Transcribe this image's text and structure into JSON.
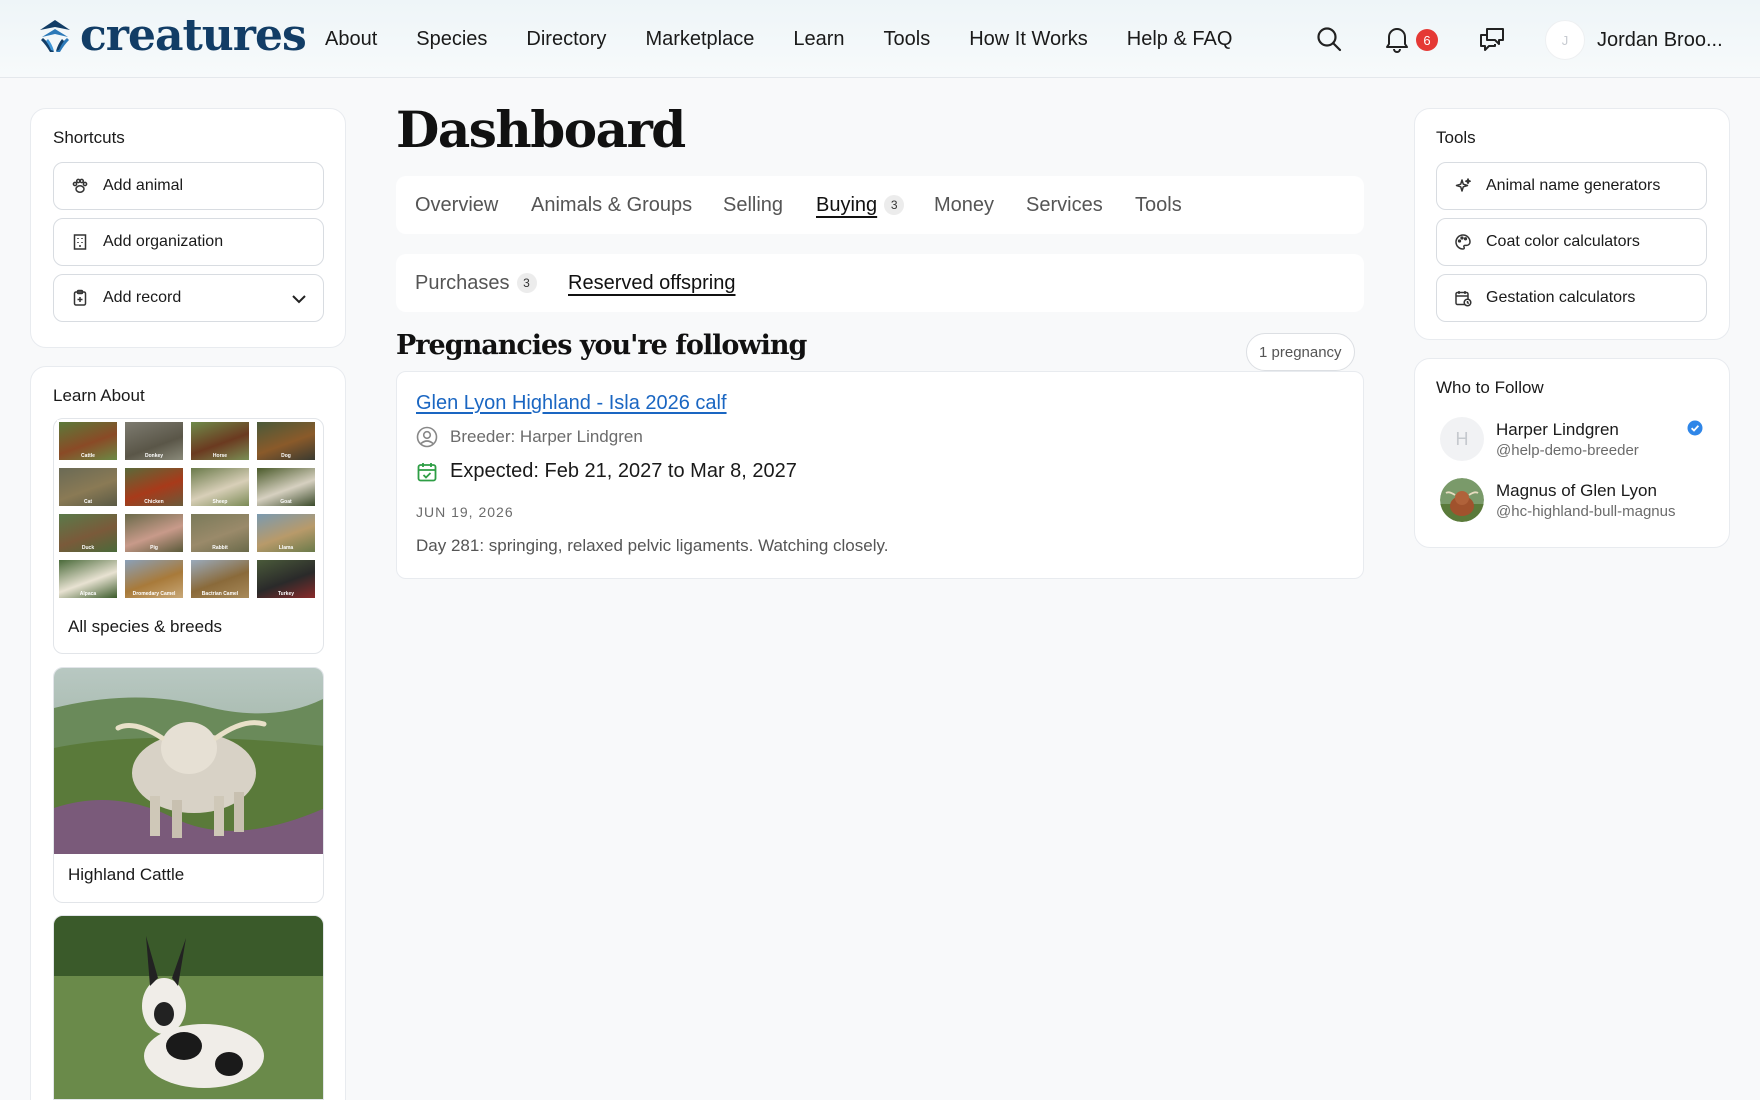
{
  "brand": {
    "name": "creatures",
    "color": "#123d66"
  },
  "nav": {
    "items": [
      "About",
      "Species",
      "Directory",
      "Marketplace",
      "Learn",
      "Tools",
      "How It Works",
      "Help & FAQ"
    ]
  },
  "header": {
    "notifications_count": "6",
    "user_initial": "J",
    "user_name": "Jordan Broo..."
  },
  "shortcuts": {
    "title": "Shortcuts",
    "items": [
      {
        "label": "Add animal",
        "icon": "paw-icon"
      },
      {
        "label": "Add organization",
        "icon": "building-icon"
      },
      {
        "label": "Add record",
        "icon": "clipboard-icon"
      }
    ]
  },
  "learn": {
    "title": "Learn About",
    "species_tiles": [
      "Cattle",
      "Donkey",
      "Horse",
      "Dog",
      "Cat",
      "Chicken",
      "Sheep",
      "Goat",
      "Duck",
      "Pig",
      "Rabbit",
      "Llama",
      "Alpaca",
      "Dromedary Camel",
      "Bactrian Camel",
      "Turkey"
    ],
    "all_label": "All species & breeds",
    "cards": [
      {
        "label": "Highland Cattle"
      }
    ]
  },
  "main": {
    "title": "Dashboard",
    "tabs": [
      {
        "label": "Overview"
      },
      {
        "label": "Animals & Groups"
      },
      {
        "label": "Selling"
      },
      {
        "label": "Buying",
        "count": "3"
      },
      {
        "label": "Money"
      },
      {
        "label": "Services"
      },
      {
        "label": "Tools"
      }
    ],
    "subtabs": [
      {
        "label": "Purchases",
        "count": "3"
      },
      {
        "label": "Reserved offspring"
      }
    ],
    "section_title": "Pregnancies you're following",
    "count_label": "1 pregnancy",
    "pregnancy": {
      "title": "Glen Lyon Highland - Isla 2026 calf",
      "breeder": "Breeder: Harper Lindgren",
      "expected": "Expected: Feb 21, 2027 to Mar 8, 2027",
      "date": "JUN 19, 2026",
      "note": "Day 281: springing, relaxed pelvic ligaments. Watching closely."
    }
  },
  "tools": {
    "title": "Tools",
    "items": [
      {
        "label": "Animal name generators",
        "icon": "sparkle-icon"
      },
      {
        "label": "Coat color calculators",
        "icon": "palette-icon"
      },
      {
        "label": "Gestation calculators",
        "icon": "calendar-clock-icon"
      }
    ]
  },
  "follow": {
    "title": "Who to Follow",
    "people": [
      {
        "initial": "H",
        "name": "Harper Lindgren",
        "handle": "@help-demo-breeder",
        "verified": true
      },
      {
        "name": "Magnus of Glen Lyon",
        "handle": "@hc-highland-bull-magnus"
      }
    ]
  },
  "colors": {
    "link": "#1a66c2",
    "badge": "#e53935",
    "verified": "#2f86e8",
    "calendar": "#2e9e45"
  }
}
